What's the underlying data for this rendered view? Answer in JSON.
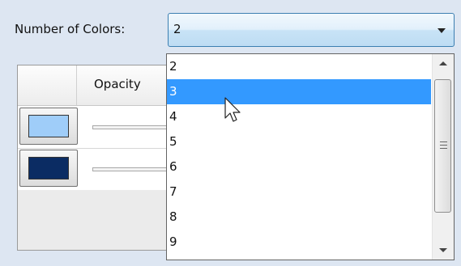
{
  "form": {
    "label": "Number of Colors:"
  },
  "combo": {
    "value": "2"
  },
  "grid": {
    "header": {
      "opacity": "Opacity"
    },
    "rows": [
      {
        "color": "#9fcdf9"
      },
      {
        "color": "#0b2c63"
      }
    ]
  },
  "dropdown": {
    "options": [
      "2",
      "3",
      "4",
      "5",
      "6",
      "7",
      "8",
      "9"
    ],
    "highlighted": "3"
  },
  "icons": {
    "dropdown_arrow": "chevron-down-icon",
    "scroll_up": "scroll-up-arrow-icon",
    "scroll_down": "scroll-down-arrow-icon",
    "pointer": "mouse-pointer-icon"
  }
}
